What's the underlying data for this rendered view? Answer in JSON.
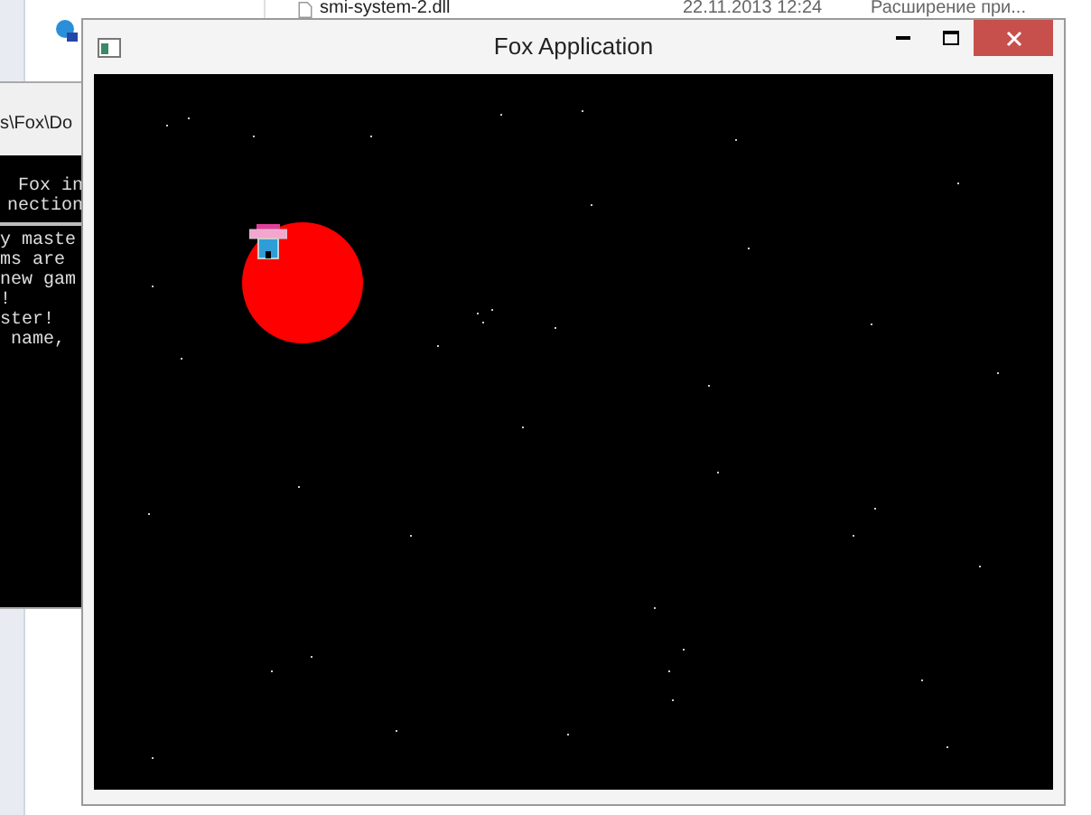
{
  "explorer_row": {
    "file_name": "smi-system-2.dll",
    "date": "22.11.2013 12:24",
    "type": "Расширение при..."
  },
  "console": {
    "path": "s\\Fox\\Do",
    "header_lines": [
      "Fox in",
      "nection"
    ],
    "lines": [
      "y maste",
      "ms are",
      "new gam",
      "!",
      "ster!",
      " name,"
    ]
  },
  "window": {
    "title": "Fox Application"
  }
}
